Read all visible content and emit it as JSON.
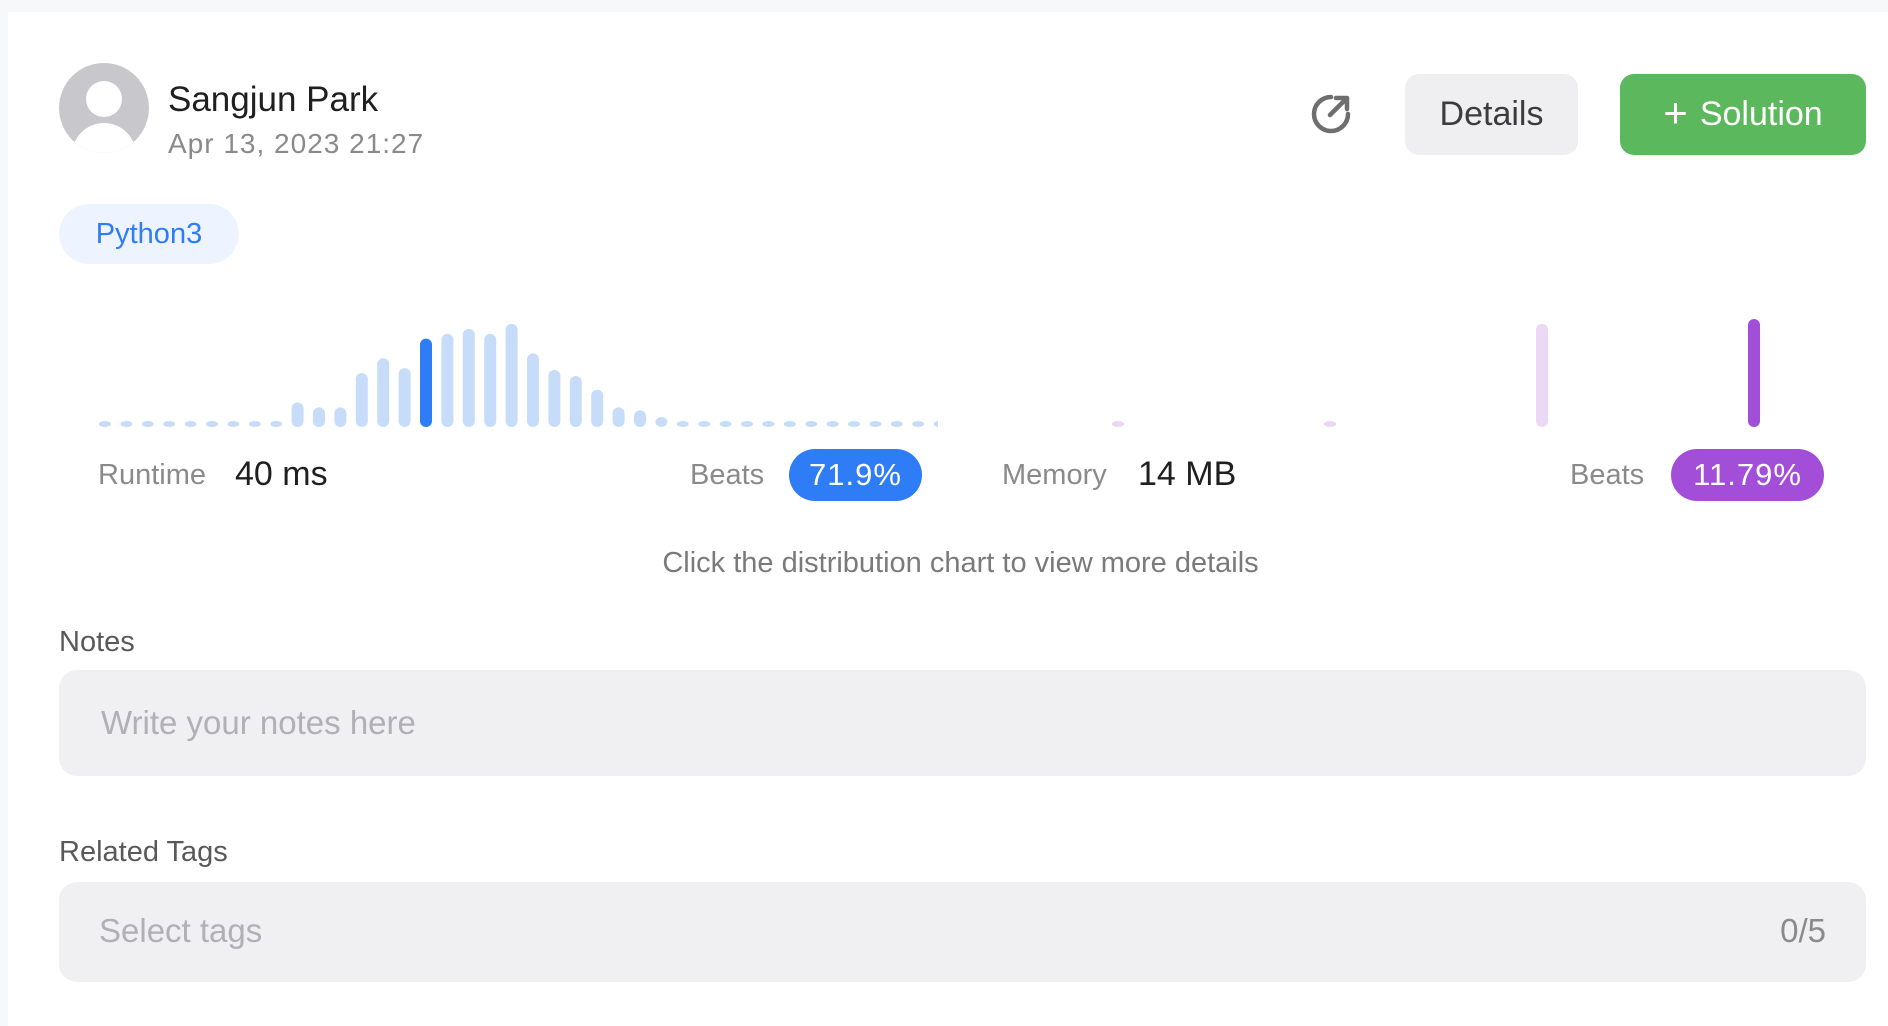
{
  "submission": {
    "user_name": "Sangjun Park",
    "timestamp": "Apr 13, 2023 21:27",
    "language": "Python3"
  },
  "toolbar": {
    "share_icon": "share-external-icon",
    "details_label": "Details",
    "solution_icon": "plus-icon",
    "solution_label": "Solution"
  },
  "colors": {
    "runtime_accent": "#2e7cf6",
    "runtime_light": "#c7dcf8",
    "memory_accent": "#a24ed8",
    "memory_light": "#ead8f5",
    "solution_green": "#5cb85c"
  },
  "runtime": {
    "label": "Runtime",
    "value": "40 ms",
    "beats_label": "Beats",
    "beats_value": "71.9%"
  },
  "memory": {
    "label": "Memory",
    "value": "14 MB",
    "beats_label": "Beats",
    "beats_value": "11.79%"
  },
  "hint": "Click the distribution chart to view more details",
  "notes": {
    "label": "Notes",
    "placeholder": "Write your notes here"
  },
  "tags": {
    "label": "Related Tags",
    "placeholder": "Select tags",
    "count": "0/5"
  },
  "chart_data": [
    {
      "type": "bar",
      "name": "runtime-distribution",
      "highlight_index": 15,
      "values": [
        0.5,
        0.5,
        0.5,
        0.5,
        0.5,
        0.5,
        0.5,
        0.5,
        0.5,
        2.5,
        2,
        2,
        5.5,
        7,
        6,
        9,
        9.5,
        10,
        9.5,
        10.5,
        7.5,
        5.8,
        5.2,
        3.8,
        2,
        1.7,
        1,
        0.5,
        0.5,
        0.5,
        0.5,
        0.5,
        0.5,
        0.5,
        0.5,
        0.5,
        0.5,
        0.5,
        0.5,
        0.5
      ]
    },
    {
      "type": "bar",
      "name": "memory-distribution",
      "highlight_index": 3,
      "values": [
        0.5,
        0.5,
        10.5,
        11
      ]
    }
  ]
}
